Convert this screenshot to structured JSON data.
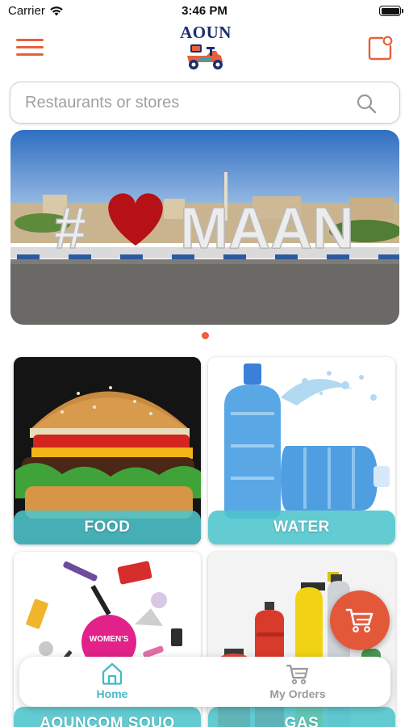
{
  "status_bar": {
    "carrier": "Carrier",
    "time": "3:46 PM"
  },
  "header": {
    "logo_text": "AOUN",
    "menu_icon": "hamburger-menu-icon",
    "chat_icon": "chat-notification-icon"
  },
  "search": {
    "placeholder": "Restaurants or stores",
    "icon": "search-icon"
  },
  "banner": {
    "text": "#♥MAAN",
    "pager": {
      "count": 1,
      "active": 1
    }
  },
  "categories": [
    {
      "label": "FOOD"
    },
    {
      "label": "WATER"
    },
    {
      "label": "AOUNCOM SOUQ",
      "badge": "WOMEN'S"
    },
    {
      "label": "GAS"
    }
  ],
  "fab": {
    "icon": "cart-icon"
  },
  "tabs": [
    {
      "label": "Home",
      "icon": "home-icon",
      "active": true
    },
    {
      "label": "My Orders",
      "icon": "cart-icon",
      "active": false
    }
  ],
  "colors": {
    "accent": "#e8603c",
    "teal": "#4dc4cc",
    "logo_blue": "#1c2f6e"
  }
}
